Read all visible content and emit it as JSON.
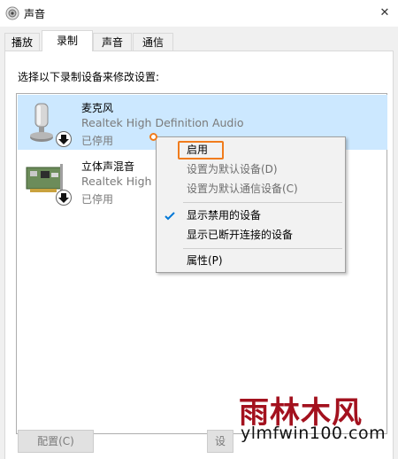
{
  "window": {
    "title": "声音",
    "close_glyph": "✕"
  },
  "tabs": [
    {
      "label": "播放",
      "active": false
    },
    {
      "label": "录制",
      "active": true
    },
    {
      "label": "声音",
      "active": false
    },
    {
      "label": "通信",
      "active": false
    }
  ],
  "instruction": "选择以下录制设备来修改设置:",
  "devices": [
    {
      "name": "麦克风",
      "driver": "Realtek High Definition Audio",
      "status": "已停用",
      "icon": "microphone-icon",
      "selected": true
    },
    {
      "name": "立体声混音",
      "driver": "Realtek High Definition Audio",
      "status": "已停用",
      "icon": "sound-card-icon",
      "selected": false
    }
  ],
  "context_menu": {
    "items": [
      {
        "label": "启用",
        "enabled": true,
        "checked": false,
        "highlighted": true
      },
      {
        "label": "设置为默认设备(D)",
        "enabled": false,
        "checked": false
      },
      {
        "label": "设置为默认通信设备(C)",
        "enabled": false,
        "checked": false
      },
      {
        "label": "显示禁用的设备",
        "enabled": true,
        "checked": true
      },
      {
        "label": "显示已断开连接的设备",
        "enabled": true,
        "checked": false
      },
      {
        "label": "属性(P)",
        "enabled": true,
        "checked": false
      }
    ],
    "check_color": "#0078d7",
    "highlight_color": "#f07c1d"
  },
  "buttons": {
    "configure": "配置(C)",
    "set_default_partial": "设"
  },
  "watermark": {
    "text": "雨林木风",
    "url": "ylmfwin100.com",
    "color": "#a3111e"
  },
  "colors": {
    "selection": "#cce8ff",
    "window_bg": "#f0f0f0"
  }
}
